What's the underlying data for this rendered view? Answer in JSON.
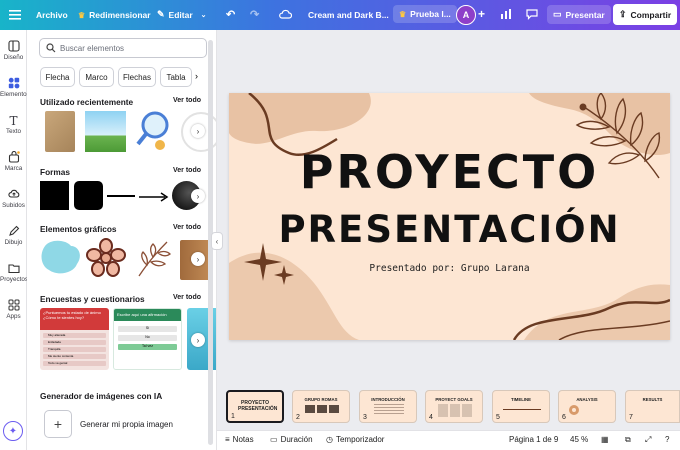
{
  "topbar": {
    "file": "Archivo",
    "resize": "Redimensionar",
    "edit": "Editar",
    "doc_title": "Cream and Dark B...",
    "trial": "Prueba l...",
    "avatar": "A",
    "present": "Presentar",
    "share": "Compartir"
  },
  "rail": [
    {
      "label": "Diseño",
      "icon": "layout-icon"
    },
    {
      "label": "Elementos",
      "icon": "shapes-icon"
    },
    {
      "label": "Texto",
      "icon": "text-icon"
    },
    {
      "label": "Marca",
      "icon": "brand-icon"
    },
    {
      "label": "Subidos",
      "icon": "upload-icon"
    },
    {
      "label": "Dibujo",
      "icon": "draw-icon"
    },
    {
      "label": "Proyectos",
      "icon": "folder-icon"
    },
    {
      "label": "Apps",
      "icon": "apps-icon"
    }
  ],
  "panel": {
    "search_placeholder": "Buscar elementos",
    "chips": [
      "Flecha",
      "Marco",
      "Flechas",
      "Tabla"
    ],
    "recent": "Utilizado recientemente",
    "shapes": "Formas",
    "graphics": "Elementos gráficos",
    "polls": "Encuestas y cuestionarios",
    "see_all": "Ver todo",
    "ai_title": "Generador de imágenes con IA",
    "ai_generate": "Generar mi propia imagen",
    "poll1_title": "¿Puntuemos tu estado de ánimo ¿Cómo te sientes hoy?",
    "poll2_title": "Escribe aquí una afirmación",
    "poll1_options": [
      "Muy alterada",
      "Enfadada",
      "Tranquila",
      "Me siento contenta",
      "Todo va genial"
    ],
    "poll2_options": [
      "Sí",
      "No",
      "Tal vez"
    ]
  },
  "slide": {
    "title_line1": "PROYECTO",
    "title_line2": "PRESENTACIÓN",
    "subtitle": "Presentado por: Grupo Larana"
  },
  "thumbs": [
    {
      "num": "1",
      "title": "PROYECTO PRESENTACIÓN"
    },
    {
      "num": "2",
      "title": "GRUPO ROMAS"
    },
    {
      "num": "3",
      "title": "INTRODUCCIÓN"
    },
    {
      "num": "4",
      "title": "PROYECT GOALS"
    },
    {
      "num": "5",
      "title": "TIMELINE"
    },
    {
      "num": "6",
      "title": "ANALYSIS"
    },
    {
      "num": "7",
      "title": "RESULTS"
    }
  ],
  "bottombar": {
    "notes": "Notas",
    "duration": "Duración",
    "timer": "Temporizador",
    "page": "Página 1 de 9",
    "zoom": "45 %"
  },
  "colors": {
    "slide_bg": "#fde6d3",
    "accent_shapes": "#e8c2a4",
    "brown": "#6a3b22",
    "topbar_from": "#18b4c9",
    "topbar_to": "#7b3fe4"
  }
}
